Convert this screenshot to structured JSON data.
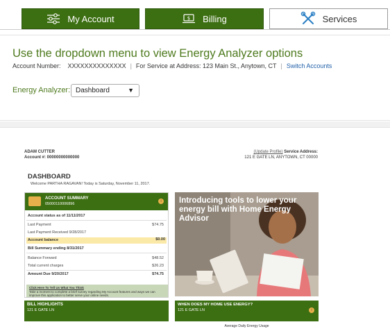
{
  "nav": {
    "tabs": [
      {
        "label": "My Account",
        "icon": "sliders-icon"
      },
      {
        "label": "Billing",
        "icon": "laptop-dollar-icon"
      },
      {
        "label": "Services",
        "icon": "wrench-screwdriver-icon"
      }
    ]
  },
  "header": {
    "title": "Use the dropdown menu to view Energy Analyzer options",
    "account_label": "Account Number:",
    "account_number": "XXXXXXXXXXXXXX",
    "service_label": "For Service at Address: 123 Main St., Anytown, CT",
    "switch_link": "Switch Accounts",
    "analyzer_label": "Energy Analyzer:",
    "analyzer_selected": "Dashboard"
  },
  "report": {
    "customer_name": "ADAM CUTTER",
    "account_line": "Account #: 00000000000000",
    "update_profile": "(Update Profile)",
    "service_address_label": "Service Address:",
    "service_address": "121 E GATE LN, ANYTOWN, CT 00000",
    "dashboard_title": "DASHBOARD",
    "welcome": "Welcome PARTHA RAGAVAN! Today is Saturday, November 11, 2017.",
    "summary": {
      "title": "ACCOUNT SUMMARY",
      "number": "05000110006896",
      "status_heading": "Account status as of 11/11/2017",
      "rows": [
        {
          "label": "Last Payment",
          "value": "$74.75"
        },
        {
          "label": "Last Payment Received 9/28/2017",
          "value": ""
        }
      ],
      "balance_label": "Account balance",
      "balance_value": "$0.00",
      "bill_heading": "Bill Summary ending 8/31/2017",
      "bill_rows": [
        {
          "label": "Balance Forward",
          "value": "$48.52"
        },
        {
          "label": "Total current charges",
          "value": "$26.23"
        }
      ],
      "due_label": "Amount Due 9/20/2017",
      "due_value": "$74.75",
      "tell_us_link": "Click Here To Tell Us What You Think",
      "tell_us_text": "Take a moment to complete a brief survey regarding My Account features and ways we can improve this application to better serve your online needs."
    },
    "bill_highlights": {
      "title": "BILL HIGHLIGHTS",
      "address": "121 E GATE LN"
    },
    "promo": {
      "text": "Introducing tools to lower your energy bill with Home Energy Advisor"
    },
    "home_energy": {
      "title": "WHEN DOES MY HOME USE ENERGY?",
      "address": "121 E GATE LN",
      "sub": "Average Daily Energy Usage"
    }
  }
}
